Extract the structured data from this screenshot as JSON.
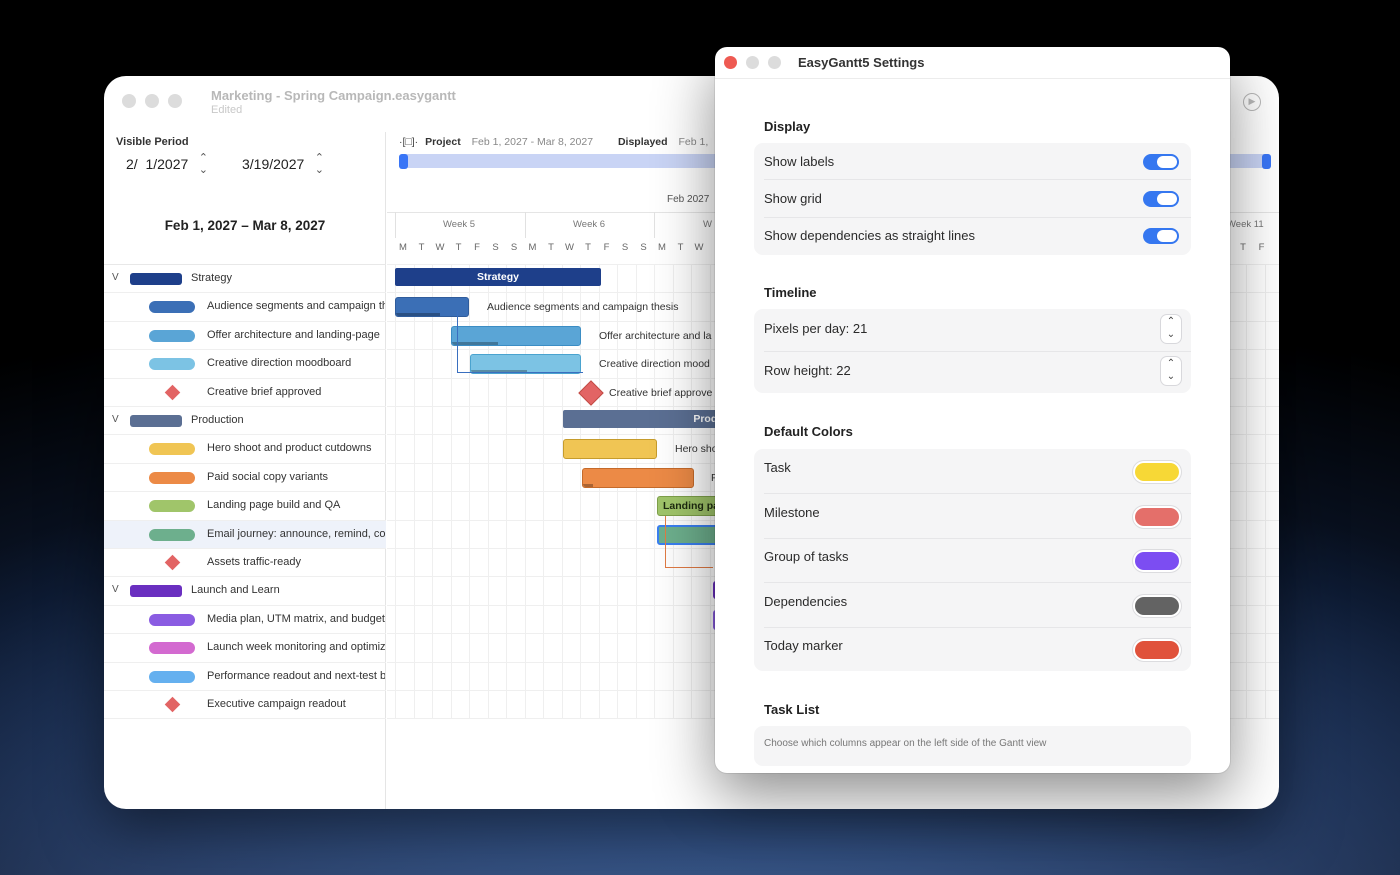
{
  "main_window": {
    "title": "Marketing - Spring Campaign.easygantt",
    "subtitle": "Edited",
    "visible_period_label": "Visible Period",
    "start_date": "2/  1/2027",
    "end_date": "3/19/2027",
    "range_heading": "Feb 1, 2027 – Mar 8, 2027",
    "project_label": "Project",
    "project_range": "Feb 1, 2027 - Mar 8, 2027",
    "displayed_label": "Displayed",
    "displayed_range": "Feb 1,",
    "month_label": "Feb 2027",
    "week_labels": [
      "Week 5",
      "Week 6",
      "W",
      "Week 11"
    ],
    "day_letters": [
      "M",
      "T",
      "W",
      "T",
      "F",
      "S",
      "S",
      "M",
      "T",
      "W",
      "T",
      "F",
      "S",
      "S",
      "M",
      "T",
      "W"
    ],
    "day_letters_right": [
      "T",
      "F"
    ],
    "tasks": [
      {
        "label": "Strategy",
        "kind": "group",
        "color": "#1e3f8a"
      },
      {
        "label": "Audience segments and campaign th",
        "kind": "task",
        "color": "#3b6fb6"
      },
      {
        "label": "Offer architecture and landing-page",
        "kind": "task",
        "color": "#5aa5d6"
      },
      {
        "label": "Creative direction moodboard",
        "kind": "task",
        "color": "#7cc3e4"
      },
      {
        "label": "Creative brief approved",
        "kind": "milestone",
        "color": "#e26464"
      },
      {
        "label": "Production",
        "kind": "group",
        "color": "#5b6f93"
      },
      {
        "label": "Hero shoot and product cutdowns",
        "kind": "task",
        "color": "#f0c554"
      },
      {
        "label": "Paid social copy variants",
        "kind": "task",
        "color": "#ec8a46"
      },
      {
        "label": "Landing page build and QA",
        "kind": "task",
        "color": "#a0c56a"
      },
      {
        "label": "Email journey: announce, remind, co",
        "kind": "task",
        "color": "#6daf8d"
      },
      {
        "label": "Assets traffic-ready",
        "kind": "milestone",
        "color": "#e26464"
      },
      {
        "label": "Launch and Learn",
        "kind": "group",
        "color": "#6a2fc0"
      },
      {
        "label": "Media plan, UTM matrix, and budget",
        "kind": "task",
        "color": "#8a5ce2"
      },
      {
        "label": "Launch week monitoring and optimiz",
        "kind": "task",
        "color": "#d36ad0"
      },
      {
        "label": "Performance readout and next-test b",
        "kind": "task",
        "color": "#65b0ef"
      },
      {
        "label": "Executive campaign readout",
        "kind": "milestone",
        "color": "#e26464"
      }
    ],
    "chart": {
      "strategy_bar": "Strategy",
      "production_bar": "Product",
      "audience_label": "Audience segments and campaign thesis",
      "offer_label": "Offer architecture and la",
      "creative_label": "Creative direction mood",
      "brief_label": "Creative brief approve",
      "hero_label": "Hero sho",
      "paid_label": "P",
      "landing_label": "Landing pa"
    }
  },
  "settings": {
    "title": "EasyGantt5 Settings",
    "display": {
      "heading": "Display",
      "items": [
        {
          "label": "Show labels",
          "on": true
        },
        {
          "label": "Show grid",
          "on": true
        },
        {
          "label": "Show dependencies as straight lines",
          "on": true
        }
      ]
    },
    "timeline": {
      "heading": "Timeline",
      "pixels_per_day": "Pixels per day: 21",
      "row_height": "Row height: 22"
    },
    "default_colors": {
      "heading": "Default Colors",
      "items": [
        {
          "label": "Task",
          "color": "#f7d836"
        },
        {
          "label": "Milestone",
          "color": "#e46f6a"
        },
        {
          "label": "Group of tasks",
          "color": "#7c4df2"
        },
        {
          "label": "Dependencies",
          "color": "#636363"
        },
        {
          "label": "Today marker",
          "color": "#e0523b"
        }
      ]
    },
    "task_list": {
      "heading": "Task List",
      "description": "Choose which columns appear on the left side of the Gantt view"
    }
  }
}
